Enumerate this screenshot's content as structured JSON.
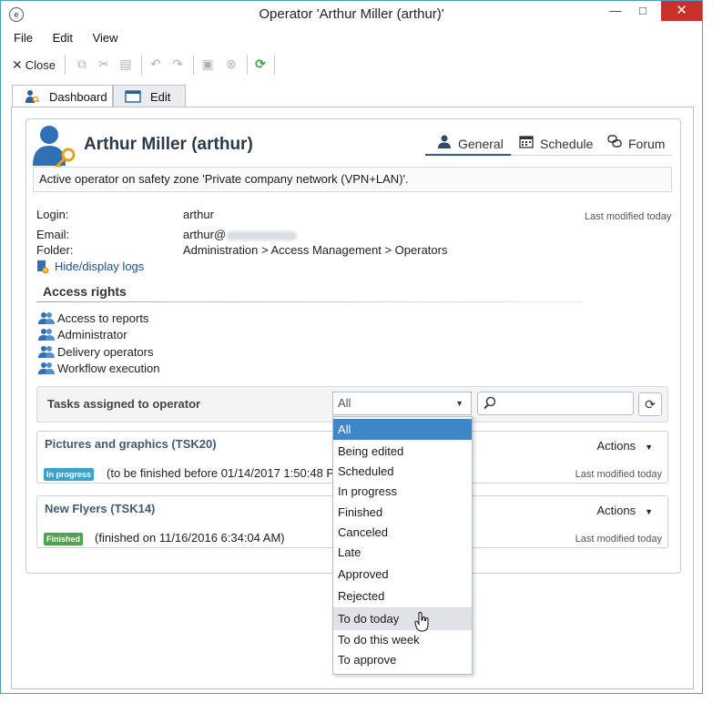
{
  "window": {
    "title": "Operator 'Arthur Miller (arthur)'",
    "controls": {
      "minimize": "—",
      "maximize": "□",
      "close": "✕"
    }
  },
  "menu": {
    "items": [
      "File",
      "Edit",
      "View"
    ]
  },
  "toolbar": {
    "close_label": "Close"
  },
  "tabs": [
    {
      "label": "Dashboard",
      "active": true
    },
    {
      "label": "Edit",
      "active": false
    }
  ],
  "operator": {
    "name": "Arthur Miller (arthur)",
    "description": "Active operator on safety zone 'Private company network (VPN+LAN)'.",
    "last_modified": "Last modified today",
    "fields": {
      "login_label": "Login:",
      "login_value": "arthur",
      "email_label": "Email:",
      "email_value": "arthur@",
      "folder_label": "Folder:",
      "folder_value": "Administration > Access Management > Operators"
    },
    "logs_link": "Hide/display logs"
  },
  "subtabs": [
    {
      "label": "General",
      "active": true,
      "icon": "user-icon"
    },
    {
      "label": "Schedule",
      "active": false,
      "icon": "calendar-icon"
    },
    {
      "label": "Forum",
      "active": false,
      "icon": "forum-icon"
    }
  ],
  "access_rights": {
    "title": "Access rights",
    "items": [
      "Access to reports",
      "Administrator",
      "Delivery operators",
      "Workflow execution"
    ]
  },
  "tasks": {
    "title": "Tasks assigned to operator",
    "filter_value": "All",
    "filter_options": [
      "All",
      "Being edited",
      "Scheduled",
      "In progress",
      "Finished",
      "Canceled",
      "Late",
      "Approved",
      "Rejected",
      "To do today",
      "To do this week",
      "To approve"
    ],
    "selected_option": "All",
    "hover_option": "To do today",
    "search_value": "",
    "items": [
      {
        "title": "Pictures and graphics (TSK20)",
        "actions_label": "Actions",
        "badge": "In progress",
        "badge_color": "#3aa3c9",
        "status_text": "(to be finished before 01/14/2017 1:50:48 PM)",
        "last_modified": "Last modified today"
      },
      {
        "title": "New Flyers (TSK14)",
        "actions_label": "Actions",
        "badge": "Finished",
        "badge_color": "#4fa34a",
        "status_text": "(finished on 11/16/2016 6:34:04 AM)",
        "last_modified": "Last modified today"
      }
    ]
  },
  "colors": {
    "accent": "#3f86c9",
    "link": "#1d4f8a",
    "close_button": "#c7312a",
    "refresh_green": "#3aa84a"
  }
}
